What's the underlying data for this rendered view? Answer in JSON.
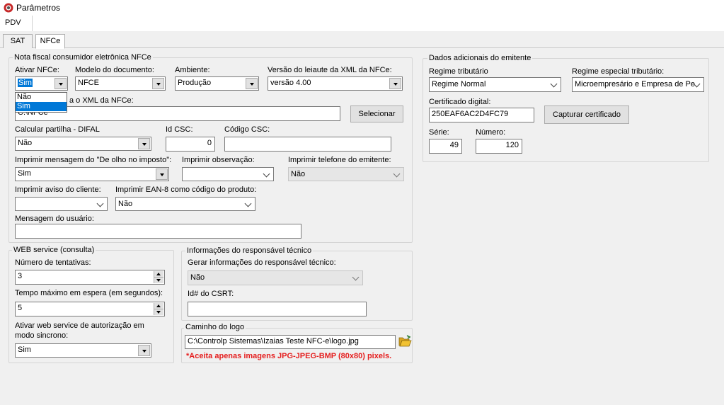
{
  "window": {
    "title": "Parâmetros",
    "icon": "app-logo-icon"
  },
  "tabs": {
    "main": "PDV",
    "sub": [
      "SAT",
      "NFCe"
    ]
  },
  "nfce": {
    "title": "Nota fiscal consumidor eletrônica NFCe",
    "ativar": {
      "label": "Ativar NFCe:",
      "value": "Sim",
      "options": [
        "Não",
        "Sim"
      ]
    },
    "modelo": {
      "label": "Modelo do documento:",
      "value": "NFCE"
    },
    "ambiente": {
      "label": "Ambiente:",
      "value": "Produção"
    },
    "versao": {
      "label": "Versão do leiaute da XML da NFCe:",
      "value": "versão 4.00"
    },
    "pasta": {
      "label_visible": "a o XML da NFCe:",
      "value": "C:\\NFCe",
      "button": "Selecionar"
    },
    "difal": {
      "label": "Calcular partilha - DIFAL",
      "value": "Não"
    },
    "idcsc": {
      "label": "Id CSC:",
      "value": "0"
    },
    "codcsc": {
      "label": "Código CSC:",
      "value": ""
    },
    "olho": {
      "label": "Imprimir mensagem do \"De olho no imposto\":",
      "value": "Sim"
    },
    "obs": {
      "label": "Imprimir observação:",
      "value": ""
    },
    "telefone": {
      "label": "Imprimir telefone do emitente:",
      "value": "Não"
    },
    "aviso": {
      "label": "Imprimir aviso do cliente:",
      "value": ""
    },
    "ean8": {
      "label": "Imprimir EAN-8 como código do produto:",
      "value": "Não"
    },
    "mensagem": {
      "label": "Mensagem do usuário:",
      "value": ""
    }
  },
  "emitente": {
    "title": "Dados adicionais do emitente",
    "regime": {
      "label": "Regime tributário",
      "value": "Regime Normal"
    },
    "regime_especial": {
      "label": "Regime especial tributário:",
      "value": "Microempresário e Empresa de Pe"
    },
    "certificado": {
      "label": "Certificado digital:",
      "value": "250EAF6AC2D4FC79",
      "button": "Capturar certificado"
    },
    "serie": {
      "label": "Série:",
      "value": "49"
    },
    "numero": {
      "label": "Número:",
      "value": "120"
    }
  },
  "webservice": {
    "title": "WEB service (consulta)",
    "tentativas": {
      "label": "Número de tentativas:",
      "value": "3"
    },
    "tempo": {
      "label": "Tempo máximo em espera (em segundos):",
      "value": "5"
    },
    "sincrono": {
      "label1": "Ativar web service de autorização em",
      "label2": "modo sincrono:",
      "value": "Sim"
    }
  },
  "responsavel": {
    "title": "Informações do responsável técnico",
    "gerar": {
      "label": "Gerar informações do responsável técnico:",
      "value": "Não"
    },
    "csrt": {
      "label": "Id# do CSRT:",
      "value": ""
    }
  },
  "logo": {
    "title": "Caminho do logo",
    "path": "C:\\Controlp Sistemas\\Izaias Teste NFC-e\\logo.jpg",
    "warning": "*Aceita apenas imagens JPG-JPEG-BMP (80x80) pixels.",
    "folder_icon": "folder-open-icon",
    "folder_color": "#f1c232"
  }
}
